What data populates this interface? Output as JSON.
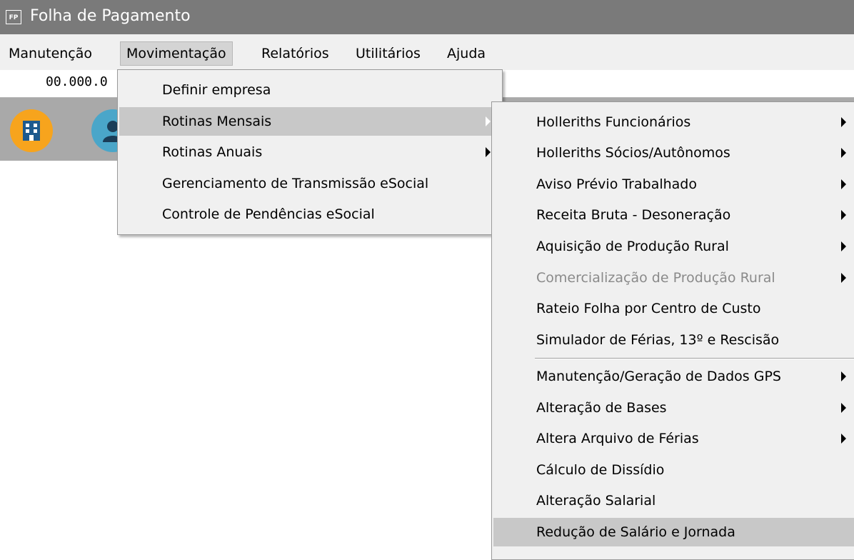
{
  "window": {
    "icon_text": "FP",
    "title": "Folha de Pagamento"
  },
  "menubar": [
    "Manutenção",
    "Movimentação",
    "Relatórios",
    "Utilitários",
    "Ajuda"
  ],
  "company_code": "00.000.0",
  "movimentacao_menu": [
    {
      "label": "Definir empresa",
      "submenu": false
    },
    {
      "label": "Rotinas Mensais",
      "submenu": true
    },
    {
      "label": "Rotinas Anuais",
      "submenu": true
    },
    {
      "label": "Gerenciamento de Transmissão eSocial",
      "submenu": false
    },
    {
      "label": "Controle de Pendências eSocial",
      "submenu": false
    }
  ],
  "rotinas_mensais_menu": [
    {
      "label": "Holleriths Funcionários",
      "submenu": true
    },
    {
      "label": "Holleriths Sócios/Autônomos",
      "submenu": true
    },
    {
      "label": "Aviso Prévio Trabalhado",
      "submenu": true
    },
    {
      "label": "Receita Bruta - Desoneração",
      "submenu": true
    },
    {
      "label": "Aquisição de Produção Rural",
      "submenu": true
    },
    {
      "label": "Comercialização de Produção Rural",
      "submenu": true,
      "disabled": true
    },
    {
      "label": "Rateio Folha por Centro de Custo",
      "submenu": false
    },
    {
      "label": "Simulador de Férias, 13º e Rescisão",
      "submenu": false
    },
    {
      "label": "Manutenção/Geração de Dados GPS",
      "submenu": true
    },
    {
      "label": "Alteração de Bases",
      "submenu": true
    },
    {
      "label": "Altera Arquivo de Férias",
      "submenu": true
    },
    {
      "label": "Cálculo de Dissídio",
      "submenu": false
    },
    {
      "label": "Alteração Salarial",
      "submenu": false
    },
    {
      "label": "Redução de Salário e Jornada",
      "submenu": false
    }
  ],
  "toolbar_icons": [
    "company-icon",
    "person-icon"
  ],
  "colors": {
    "titlebar": "#7a7a7a",
    "menu_bg": "#f0f0f0",
    "highlight": "#c8c8c8",
    "toolbar": "#a9a9a9"
  }
}
